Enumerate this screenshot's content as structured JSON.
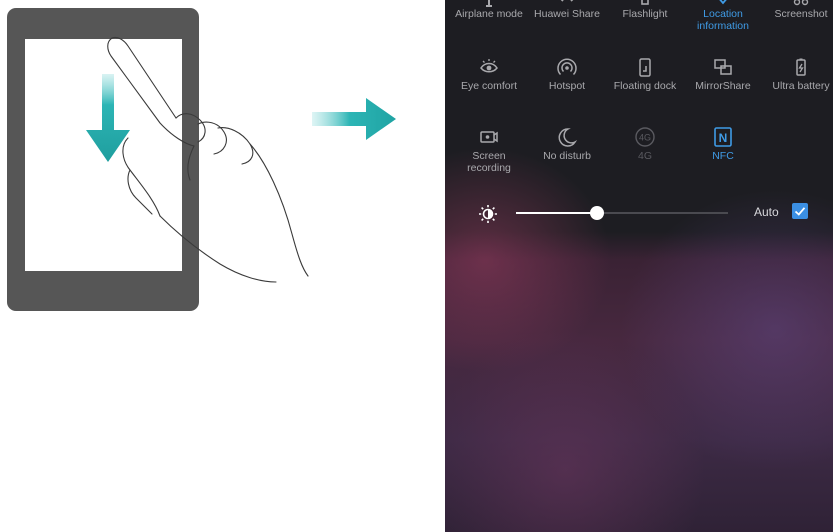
{
  "quick_settings": {
    "row1": [
      {
        "label": "Airplane mode",
        "icon": "airplane-icon",
        "state": "inactive"
      },
      {
        "label": "Huawei Share",
        "icon": "huawei-share-icon",
        "state": "inactive"
      },
      {
        "label": "Flashlight",
        "icon": "flashlight-icon",
        "state": "inactive"
      },
      {
        "label": "Location information",
        "icon": "location-icon",
        "state": "active"
      },
      {
        "label": "Screenshot",
        "icon": "scissors-icon",
        "state": "inactive"
      }
    ],
    "row2": [
      {
        "label": "Eye comfort",
        "icon": "eye-icon",
        "state": "inactive"
      },
      {
        "label": "Hotspot",
        "icon": "hotspot-icon",
        "state": "inactive"
      },
      {
        "label": "Floating dock",
        "icon": "floating-dock-icon",
        "state": "inactive"
      },
      {
        "label": "MirrorShare",
        "icon": "mirror-share-icon",
        "state": "inactive"
      },
      {
        "label": "Ultra battery",
        "icon": "battery-icon",
        "state": "inactive"
      }
    ],
    "row3": [
      {
        "label": "Screen recording",
        "icon": "screen-record-icon",
        "state": "inactive"
      },
      {
        "label": "No disturb",
        "icon": "moon-icon",
        "state": "inactive"
      },
      {
        "label": "4G",
        "icon": "4g-icon",
        "state": "disabled",
        "icon_text": "4G"
      },
      {
        "label": "NFC",
        "icon": "nfc-icon",
        "state": "active",
        "icon_text": "N"
      }
    ]
  },
  "brightness": {
    "level": 0.38,
    "auto_label": "Auto",
    "auto_checked": true
  },
  "colors": {
    "active": "#3f9be6",
    "inactive_text": "#a9a9ad",
    "teal_arrow": "#2cb5b5",
    "phone_frame": "#565656"
  }
}
